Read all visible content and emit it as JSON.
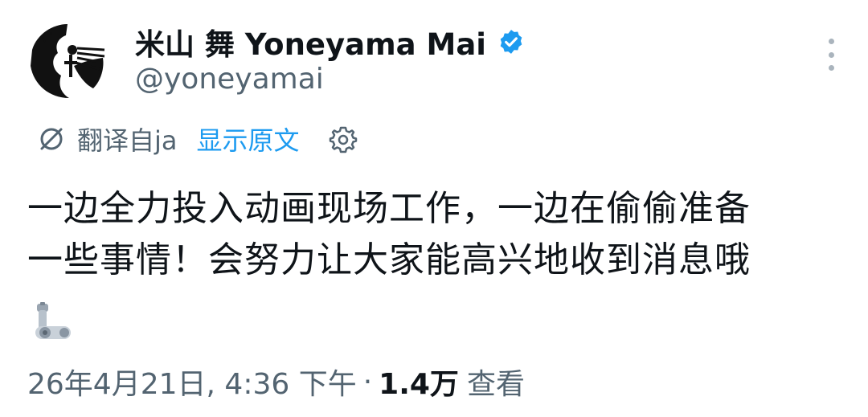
{
  "author": {
    "display_name": "米山 舞 Yoneyama Mai",
    "handle": "@yoneyamai",
    "verified_icon": "verified-badge-icon",
    "verified_color": "#1d9bf0"
  },
  "translation": {
    "icon": "translate-slash-icon",
    "translated_from": "翻译自ja",
    "show_original": "显示原文",
    "settings_icon": "gear-icon",
    "link_color": "#1d9bf0"
  },
  "tweet": {
    "lines": [
      "一边全力投入动画现场工作，一边在偷偷准备",
      "一些事情！会努力让大家能高兴地收到消息哦"
    ],
    "emoji": "mechanical-arm-emoji"
  },
  "meta": {
    "timestamp": "26年4月21日, 4:36 下午",
    "separator": "·",
    "views_count": "1.4万",
    "views_label": "查看"
  },
  "menu": {
    "icon": "more-vertical-icon"
  }
}
